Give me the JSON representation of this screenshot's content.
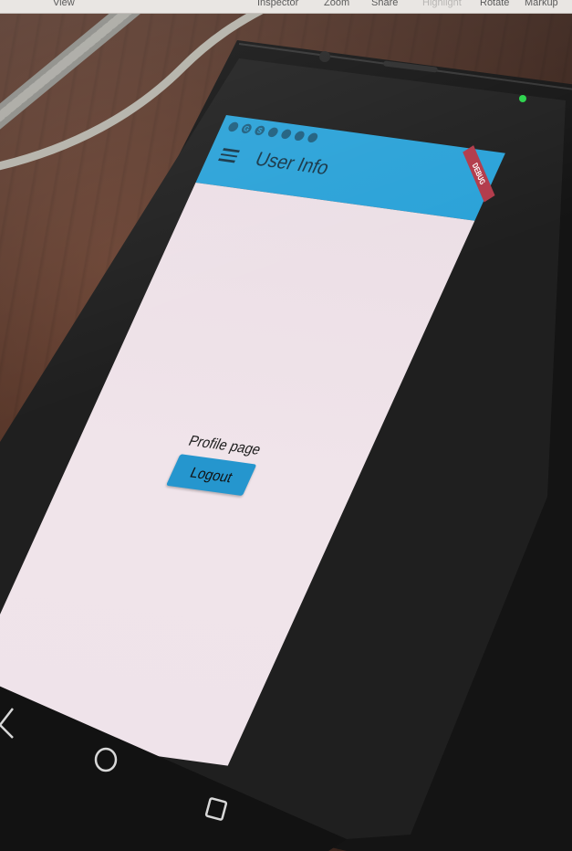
{
  "viewer_toolbar": {
    "items": [
      "View",
      "Inspector",
      "Zoom",
      "Share",
      "Highlight",
      "Rotate",
      "Markup"
    ]
  },
  "app": {
    "appbar_title": "User Info",
    "debug_banner": "DEBUG",
    "body_text": "Profile page",
    "logout_label": "Logout"
  },
  "colors": {
    "appbar": "#2aa2d8",
    "button": "#2596ce",
    "screen_background": "#efe3ea",
    "debug_banner": "#b23a4a",
    "table_wood": "#4d3025"
  },
  "icons": [
    "menu-icon",
    "back-nav-icon",
    "home-nav-icon",
    "recents-nav-icon",
    "notification-led-icon"
  ]
}
